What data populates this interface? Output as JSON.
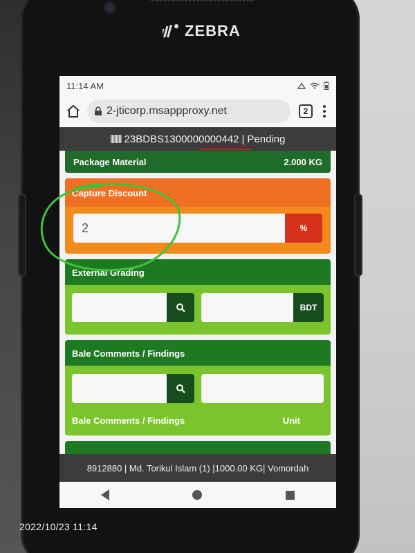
{
  "device": {
    "brand": "ZEBRA"
  },
  "status_bar": {
    "time": "11:14 AM"
  },
  "browser": {
    "url": "2-jticorp.msappproxy.net",
    "tab_count": "2"
  },
  "record_header": {
    "id": "23BDBS1300000000442",
    "separator": "|",
    "status": "Pending"
  },
  "package_material": {
    "label": "Package Material",
    "value": "2.000 KG"
  },
  "capture_discount": {
    "title": "Capture Discount",
    "value": "2",
    "unit_button": "%"
  },
  "external_grading": {
    "title": "External Grading",
    "unit_button": "BDT"
  },
  "bale_comments": {
    "title": "Bale Comments / Findings",
    "field_label": "Bale Comments / Findings",
    "unit_label": "Unit"
  },
  "footer": {
    "text": "8912880 | Md. Torikul Islam (1) |1000.00 KG| Vomordah"
  },
  "photo_timestamp": "2022/10/23 11:14",
  "colors": {
    "record_bar": "#3c3c3c",
    "discount_title": "#ef6f23",
    "discount_body": "#f28a1c",
    "percent_button": "#d8311b",
    "section_title_green": "#1e7a22",
    "section_body_green": "#7cc42d",
    "button_dark_green": "#174d1b",
    "annotation_circle": "#3ec23a",
    "annotation_underline": "#d21b1b"
  },
  "icons": [
    "home-icon",
    "lock-icon",
    "tabs-icon",
    "overflow-menu-icon",
    "search-icon",
    "back-icon",
    "home-nav-icon",
    "recents-icon",
    "wifi-icon",
    "battery-icon"
  ]
}
